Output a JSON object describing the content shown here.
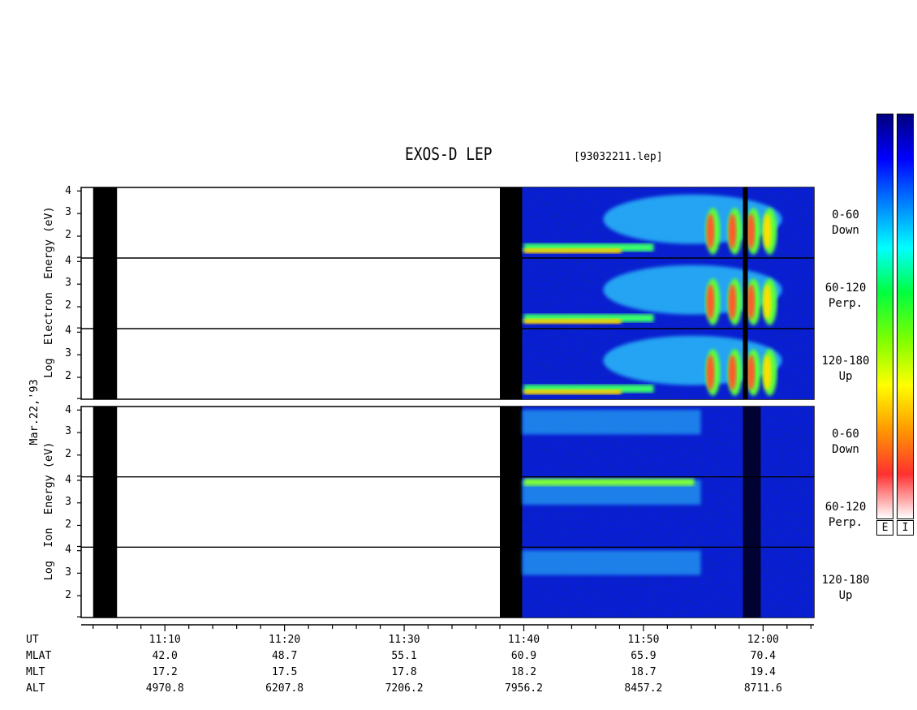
{
  "title": "EXOS-D LEP",
  "file_label": "[93032211.lep]",
  "date_label": "Mar.22,'93",
  "colorbar": {
    "labels": [
      "E",
      "I"
    ],
    "colors": [
      "#ffffff",
      "#ff3030",
      "#ff9900",
      "#ffff00",
      "#80ff00",
      "#00ff40",
      "#00ffff",
      "#0080ff",
      "#0000ff",
      "#00007f"
    ]
  },
  "chart_data": {
    "type": "heatmap",
    "title": "EXOS-D LEP",
    "panels": [
      {
        "species": "Electron",
        "ylabel": "Log Electron Energy (eV)",
        "ylabel_words": [
          "Log",
          "Electron",
          "Energy",
          "(eV)"
        ],
        "ylim": [
          1,
          4
        ],
        "bands": [
          {
            "name": "0-60 Down",
            "line1": "0-60",
            "line2": "Down",
            "ticks": [
              "4",
              "3",
              "2"
            ]
          },
          {
            "name": "60-120 Perp.",
            "line1": "60-120",
            "line2": "Perp.",
            "ticks": [
              "4",
              "3",
              "2"
            ]
          },
          {
            "name": "120-180 Up",
            "line1": "120-180",
            "line2": "Up",
            "ticks": [
              "4",
              "3",
              "2"
            ]
          }
        ]
      },
      {
        "species": "Ion",
        "ylabel": "Log Ion Energy (eV)",
        "ylabel_words": [
          "Log",
          "Ion",
          "Energy",
          "(eV)"
        ],
        "ylim": [
          1,
          4
        ],
        "bands": [
          {
            "name": "0-60 Down",
            "line1": "0-60",
            "line2": "Down",
            "ticks": [
              "4",
              "3",
              "2"
            ]
          },
          {
            "name": "60-120 Perp.",
            "line1": "60-120",
            "line2": "Perp.",
            "ticks": [
              "4",
              "3",
              "2"
            ]
          },
          {
            "name": "120-180 Up",
            "line1": "120-180",
            "line2": "Up",
            "ticks": [
              "4",
              "3",
              "2"
            ]
          }
        ]
      }
    ],
    "x_axis": {
      "row_labels": [
        "UT",
        "MLAT",
        "MLT",
        "ALT"
      ],
      "columns": [
        {
          "UT": "11:10",
          "MLAT": "42.0",
          "MLT": "17.2",
          "ALT": "4970.8"
        },
        {
          "UT": "11:20",
          "MLAT": "48.7",
          "MLT": "17.5",
          "ALT": "6207.8"
        },
        {
          "UT": "11:30",
          "MLAT": "55.1",
          "MLT": "17.8",
          "ALT": "7206.2"
        },
        {
          "UT": "11:40",
          "MLAT": "60.9",
          "MLT": "18.2",
          "ALT": "7956.2"
        },
        {
          "UT": "11:50",
          "MLAT": "65.9",
          "MLT": "18.7",
          "ALT": "8457.2"
        },
        {
          "UT": "12:00",
          "MLAT": "70.4",
          "MLT": "19.4",
          "ALT": "8711.6"
        }
      ]
    },
    "data_gaps_UT": [
      [
        "11:04",
        "11:06"
      ],
      [
        "11:38",
        "11:40"
      ]
    ],
    "data_start_UT": "11:40",
    "data_end_UT": "12:04"
  }
}
